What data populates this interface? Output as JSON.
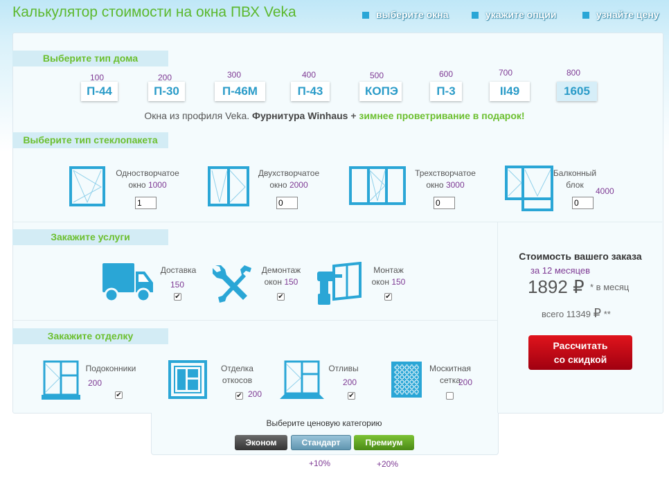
{
  "header": {
    "title": "Калькулятор стоимости на окна ПВХ Veka",
    "steps": [
      "выберите окна",
      "укажите опции",
      "узнайте цену"
    ]
  },
  "house_section": {
    "heading": "Выберите тип дома",
    "types": [
      {
        "price": "100",
        "label": "П-44"
      },
      {
        "price": "200",
        "label": "П-30"
      },
      {
        "price": "300",
        "label": "П-46М"
      },
      {
        "price": "400",
        "label": "П-43"
      },
      {
        "price": "500",
        "label": "КОПЭ"
      },
      {
        "price": "600",
        "label": "П-3"
      },
      {
        "price": "700",
        "label": "II49"
      },
      {
        "price": "800",
        "label": "1605"
      }
    ],
    "selected": "1605",
    "note_plain": "Окна из профиля Veka. ",
    "note_bold": "Фурнитура Winhaus",
    "note_plus": " + ",
    "note_green": "зимнее проветривание в подарок!"
  },
  "glass_section": {
    "heading": "Выберите тип стеклопакета",
    "items": [
      {
        "line1": "Одностворчатое",
        "line2": "окно",
        "price": "1000",
        "qty": "1",
        "icon": "single-window-icon"
      },
      {
        "line1": "Двухстворчатое",
        "line2": "окно",
        "price": "2000",
        "qty": "0",
        "icon": "double-window-icon"
      },
      {
        "line1": "Трехстворчатое",
        "line2": "окно",
        "price": "3000",
        "qty": "0",
        "icon": "triple-window-icon"
      },
      {
        "line1": "Балконный",
        "line2": "блок",
        "price": "4000",
        "qty": "0",
        "icon": "balcony-block-icon"
      }
    ]
  },
  "services_section": {
    "heading": "Закажите услуги",
    "items": [
      {
        "line1": "Доставка",
        "line2": "",
        "price": "150",
        "checked": true,
        "icon": "truck-icon"
      },
      {
        "line1": "Демонтаж",
        "line2": "окон",
        "price": "150",
        "checked": true,
        "icon": "tools-icon"
      },
      {
        "line1": "Монтаж",
        "line2": "окон",
        "price": "150",
        "checked": true,
        "icon": "drill-icon"
      }
    ]
  },
  "finish_section": {
    "heading": "Закажите отделку",
    "items": [
      {
        "line1": "Подоконники",
        "line2": "",
        "price": "200",
        "checked": true,
        "icon": "windowsill-icon"
      },
      {
        "line1": "Отделка",
        "line2": "откосов",
        "price": "200",
        "checked": true,
        "icon": "slopes-icon"
      },
      {
        "line1": "Отливы",
        "line2": "",
        "price": "200",
        "checked": true,
        "icon": "drip-icon"
      },
      {
        "line1": "Москитная",
        "line2": "сетка",
        "price": "200",
        "checked": false,
        "icon": "mosquito-net-icon"
      }
    ]
  },
  "summary": {
    "heading": "Стоимость вашего заказа",
    "term": "за 12 месяцев",
    "monthly": "1892",
    "currency": "₽",
    "monthly_suffix": "* в месяц",
    "total_prefix": "всего 11349",
    "total_suffix": "**",
    "button_line1": "Рассчитать",
    "button_line2": "со скидкой"
  },
  "price_category": {
    "prompt": "Выберите ценовую категорию",
    "options": [
      {
        "label": "Эконом",
        "color": "#4a4a4a",
        "extra": ""
      },
      {
        "label": "Стандарт",
        "color": "#6fa3bd",
        "extra": "+10%"
      },
      {
        "label": "Премиум",
        "color": "#5c9e1e",
        "extra": "+20%"
      }
    ],
    "selected": "Стандарт"
  },
  "colors": {
    "accent_blue": "#2aa6d6",
    "accent_green": "#6bbf2e",
    "price_purple": "#7e3a94",
    "cta_red": "#c8101a"
  }
}
